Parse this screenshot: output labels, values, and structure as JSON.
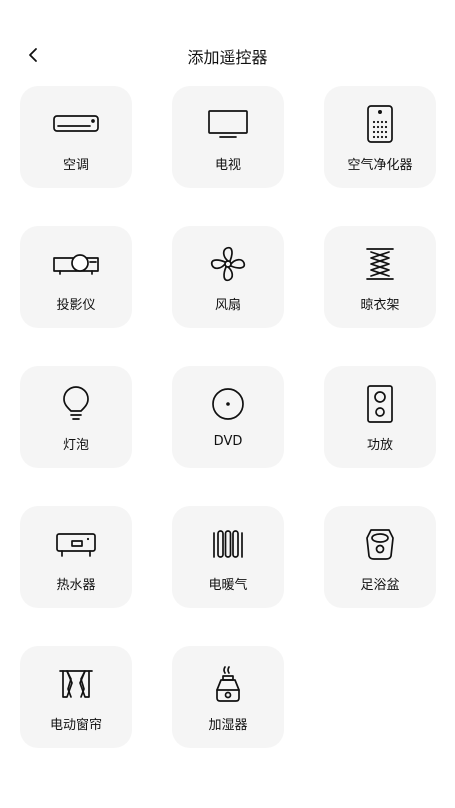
{
  "header": {
    "title": "添加遥控器",
    "back_icon": "chevron-left-icon"
  },
  "devices": [
    {
      "label": "空调",
      "icon": "air-conditioner-icon"
    },
    {
      "label": "电视",
      "icon": "tv-icon"
    },
    {
      "label": "空气净化器",
      "icon": "air-purifier-icon"
    },
    {
      "label": "投影仪",
      "icon": "projector-icon"
    },
    {
      "label": "风扇",
      "icon": "fan-icon"
    },
    {
      "label": "晾衣架",
      "icon": "clothes-rack-icon"
    },
    {
      "label": "灯泡",
      "icon": "light-bulb-icon"
    },
    {
      "label": "DVD",
      "icon": "dvd-icon"
    },
    {
      "label": "功放",
      "icon": "amplifier-icon"
    },
    {
      "label": "热水器",
      "icon": "water-heater-icon"
    },
    {
      "label": "电暖气",
      "icon": "electric-heater-icon"
    },
    {
      "label": "足浴盆",
      "icon": "foot-bath-icon"
    },
    {
      "label": "电动窗帘",
      "icon": "electric-curtain-icon"
    },
    {
      "label": "加湿器",
      "icon": "humidifier-icon"
    }
  ]
}
